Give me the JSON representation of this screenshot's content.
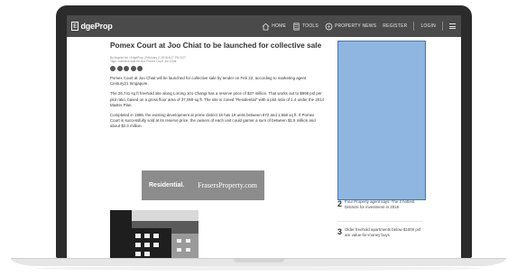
{
  "site": {
    "logo_badge": "E",
    "logo_text": "dgeProp"
  },
  "nav": {
    "items": [
      {
        "label": "HOME",
        "icon": "home-icon"
      },
      {
        "label": "TOOLS",
        "icon": "tools-icon"
      },
      {
        "label": "PROPERTY NEWS",
        "icon": "news-icon"
      }
    ],
    "register": "REGISTER",
    "login": "LOGIN"
  },
  "article": {
    "headline": "Pomex Court at Joo Chiat to be launched for collective sale",
    "byline": "By Angela Hui / EdgeProp | February 2, 2018 8:27 PM SGT",
    "tags": "Tags: collective sale  en bloc  Pomex Court  Joo Chiat",
    "paragraphs": [
      "Pomex Court at Joo Chiat will be launched for collective sale by tender on Feb 22, according to marketing agent Century21 Singapore.",
      "The 26,741 sq ft freehold site along Lorong 101 Changi has a reserve price of $37 million. That works out to $998 psf per plot ratio, based on a gross floor area of 37,059 sq ft. The site is zoned \"Residential\" with a plot ratio of 1.4 under the 2014 Master Plan.",
      "Completed in 1986, the existing development at prime district 15 has 19 units between 872 and 1,668 sq ft. If Pomex Court is successfully sold at its reserve price, the owners of each unit could garner a sum of between $1.5 million and about $2.3 million."
    ]
  },
  "ad_banner": {
    "left": "Residential.",
    "right": "FrasersProperty.com"
  },
  "trending": [
    {
      "num": "2",
      "title": "Four Property agent says: The 3 hottest Districts for investment in 2018"
    },
    {
      "num": "3",
      "title": "Older freehold apartments below $1000 psf are value-for-money buys"
    }
  ],
  "colors": {
    "navbar": "#4a4a4a",
    "sidebar_ad_fill": "#8eb6e0",
    "sidebar_ad_border": "#3a78c2",
    "ad_banner": "#8c8c8c"
  }
}
